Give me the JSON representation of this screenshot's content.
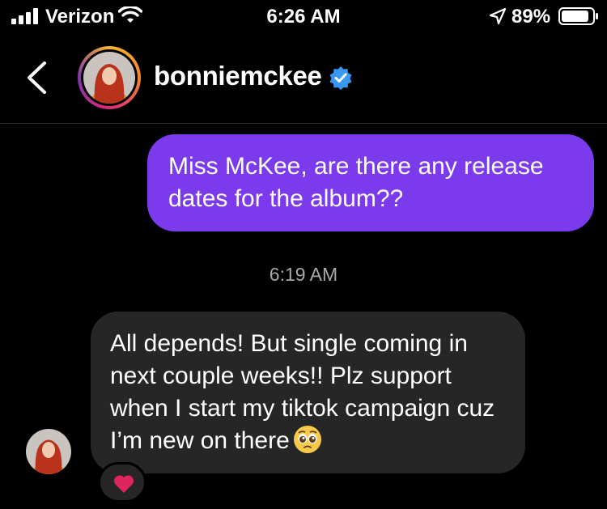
{
  "status_bar": {
    "carrier": "Verizon",
    "time": "6:26 AM",
    "battery_percent": "89%",
    "battery_level": 0.89
  },
  "header": {
    "username": "bonniemckee",
    "verified": true
  },
  "messages": [
    {
      "direction": "sent",
      "text": "Miss McKee, are there any release dates for the album??"
    },
    {
      "direction": "timestamp",
      "text": "6:19 AM"
    },
    {
      "direction": "received",
      "text": "All depends! But single coming in next couple weeks!! Plz support when I start my tiktok campaign cuz I’m new on there",
      "emoji": "pleading-face",
      "reaction": "red-heart"
    }
  ],
  "colors": {
    "background": "#000000",
    "sent_bubble": "#7c3aed",
    "received_bubble": "#262626",
    "verified_badge": "#3897f0",
    "heart": "#e0245e"
  }
}
